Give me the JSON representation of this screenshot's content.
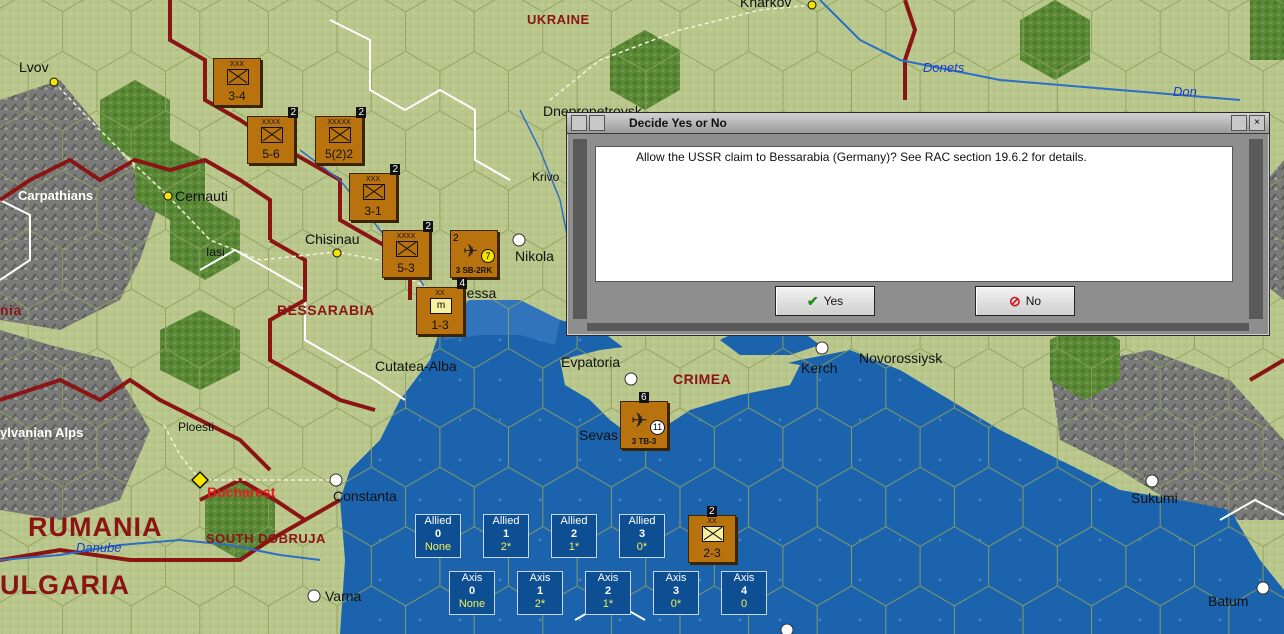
{
  "map": {
    "cities": [
      "Lvov",
      "Cernauti",
      "Chisinau",
      "Iasi",
      "Dnepropetrovsk",
      "Kharkov",
      "Krivoi",
      "Nikolaev",
      "Odessa",
      "Cutatea-Alba",
      "Evpatoria",
      "Kerch",
      "Novorossiysk",
      "Sevastopol",
      "Ploesti",
      "Bucharest",
      "Constanta",
      "Varna",
      "Sukumi",
      "Batum"
    ],
    "regions": [
      "UKRAINE",
      "BESSARABIA",
      "CRIMEA",
      "SOUTH DOBRUJA"
    ],
    "countries": [
      "RUMANIA",
      "BULGARIA"
    ],
    "terrain_labels": [
      "Carpathians",
      "Transylvanian Alps"
    ],
    "rivers": [
      "Donets",
      "Don",
      "Danube"
    ]
  },
  "labels": {
    "lvov": "Lvov",
    "cernauti": "Cernauti",
    "chisinau": "Chisinau",
    "iasi": "Iasi",
    "dnepr": "Dnepropetrovsk",
    "kharkov": "Kharkov",
    "krivoi": "Krivo",
    "nikolaev": "Nikola",
    "odessa": "Odessa",
    "cutatea": "Cutatea-Alba",
    "evpatoria": "Evpatoria",
    "kerch": "Kerch",
    "novorossiysk": "Novorossiysk",
    "sevastopol": "Sevas",
    "ploesti": "Ploesti",
    "bucharest": "Bucharest",
    "constanta": "Constanta",
    "varna": "Varna",
    "sukumi": "Sukumi",
    "batum": "Batum",
    "ukraine": "UKRAINE",
    "bessarabia": "BESSARABIA",
    "crimea": "CRIMEA",
    "south_dobruja": "SOUTH DOBRUJA",
    "rumania": "RUMANIA",
    "bulgaria": "ULGARIA",
    "carpathians": "Carpathians",
    "transylvanian": "ylvanian Alps",
    "donets": "Donets",
    "don": "Don",
    "danube": "Danube",
    "ana": "nia"
  },
  "units": [
    {
      "id": "u1",
      "strength": "3-4",
      "stack": ""
    },
    {
      "id": "u2",
      "strength": "5-6",
      "stack": "2"
    },
    {
      "id": "u3",
      "strength": "5(2)2",
      "stack": "2"
    },
    {
      "id": "u4",
      "strength": "3-1",
      "stack": "2"
    },
    {
      "id": "u5",
      "strength": "5-3",
      "stack": "2"
    },
    {
      "id": "u6",
      "strength": "3 SB-2RK",
      "stack": "",
      "badge": "7",
      "pre": "2"
    },
    {
      "id": "u7",
      "strength": "1-3",
      "stack": "4"
    },
    {
      "id": "u8",
      "strength": "3 TB-3",
      "stack": "6",
      "badge": "11"
    },
    {
      "id": "u9",
      "strength": "2-3",
      "stack": "2"
    }
  ],
  "pools": {
    "allied": [
      {
        "label": "Allied",
        "num": "0",
        "val": "None"
      },
      {
        "label": "Allied",
        "num": "1",
        "val": "2*"
      },
      {
        "label": "Allied",
        "num": "2",
        "val": "1*"
      },
      {
        "label": "Allied",
        "num": "3",
        "val": "0*"
      }
    ],
    "axis": [
      {
        "label": "Axis",
        "num": "0",
        "val": "None"
      },
      {
        "label": "Axis",
        "num": "1",
        "val": "2*"
      },
      {
        "label": "Axis",
        "num": "2",
        "val": "1*"
      },
      {
        "label": "Axis",
        "num": "3",
        "val": "0*"
      },
      {
        "label": "Axis",
        "num": "4",
        "val": "0"
      }
    ]
  },
  "dialog": {
    "title": "Decide Yes or No",
    "message": "Allow the USSR claim to Bessarabia (Germany)?  See RAC section 19.6.2 for details.",
    "yes_label": "Yes",
    "no_label": "No"
  },
  "colors": {
    "sea": "#1d64b0",
    "land": "#b7c68a",
    "forest": "#5f8f3a",
    "mountain": "#7a7a7a",
    "border": "#8b1414",
    "unit": "#b8730f"
  }
}
